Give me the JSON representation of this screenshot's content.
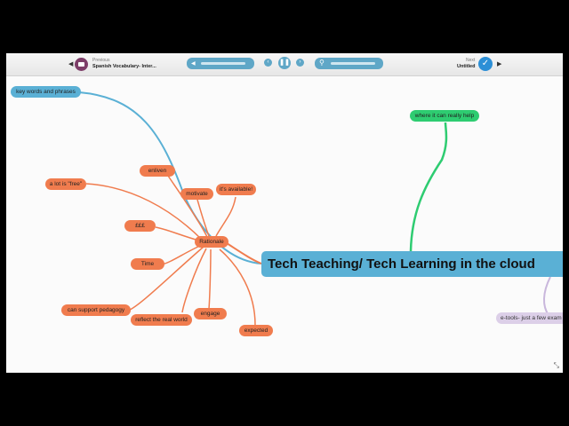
{
  "toolbar": {
    "previous_small": "Previous",
    "previous_title": "Spanish Vocabulary- Inter...",
    "next_small": "Next",
    "next_title": "Untitled"
  },
  "map": {
    "central": "Tech Teaching/ Tech Learning in the cloud",
    "rationale": "Rationale",
    "nodes": {
      "key_words": "key words and phrases",
      "where_help": "where it can really help",
      "enliven": "enliven",
      "motivate": "motivate",
      "available": "it's available!",
      "free": "a lot is \"free\"",
      "money": "£££",
      "time": "Time",
      "pedagogy": "can support pedagogy",
      "real_world": "reflect the real world",
      "engage": "engage",
      "expected": "expected",
      "etools": "e-tools- just a few exam"
    }
  },
  "colors": {
    "orange": "#f07c4e",
    "blue": "#5ab0d5",
    "green": "#2ecc71",
    "purple": "#dccfe8",
    "toolbar_accent": "#5fa7c7"
  },
  "icons": {
    "prev_doc": "document-icon",
    "next_done": "check-icon",
    "play": "pause-icon",
    "zoom": "zoom-icon",
    "volume": "volume-icon",
    "resize": "resize-icon"
  }
}
